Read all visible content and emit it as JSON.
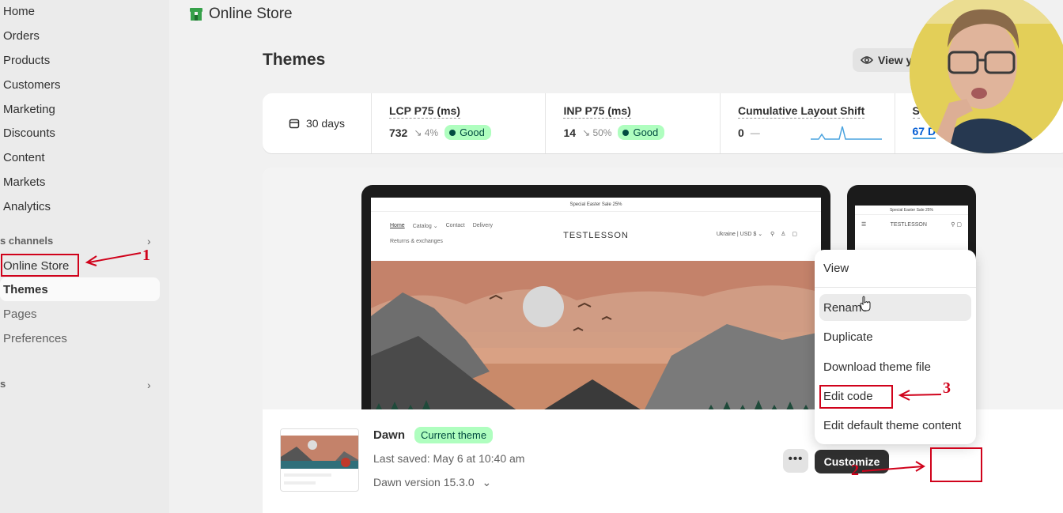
{
  "sidebar": {
    "items": [
      {
        "label": "Home"
      },
      {
        "label": "Orders"
      },
      {
        "label": "Products"
      },
      {
        "label": "Customers"
      },
      {
        "label": "Marketing"
      },
      {
        "label": "Discounts"
      },
      {
        "label": "Content"
      },
      {
        "label": "Markets"
      },
      {
        "label": "Analytics"
      }
    ],
    "sales_channels_label": "s channels",
    "online_store_label": "Online Store",
    "sub_items": [
      {
        "label": "Themes"
      },
      {
        "label": "Pages"
      },
      {
        "label": "Preferences"
      }
    ],
    "apps_label": "s"
  },
  "header": {
    "store_title": "Online Store"
  },
  "page": {
    "title": "Themes",
    "view_button_label": "View y"
  },
  "metrics": {
    "date_range": "30 days",
    "items": [
      {
        "label": "LCP P75 (ms)",
        "value": "732",
        "delta": "↘ 4%",
        "badge": "Good"
      },
      {
        "label": "INP P75 (ms)",
        "value": "14",
        "delta": "↘ 50%",
        "badge": "Good"
      },
      {
        "label": "Cumulative Layout Shift",
        "value": "0",
        "delta": "—"
      },
      {
        "label": "S",
        "value": "67 D"
      }
    ]
  },
  "preview": {
    "announcement": "Special Easter Sale 25%",
    "nav": [
      "Home",
      "Catalog ⌄",
      "Contact",
      "Delivery"
    ],
    "nav2": "Returns & exchanges",
    "logo": "TESTLESSON",
    "utility": "Ukraine | USD $ ⌄",
    "phone_announcement": "Special Easter Sale 25%",
    "phone_logo": "TESTLESSON"
  },
  "theme": {
    "name": "Dawn",
    "badge": "Current theme",
    "last_saved": "Last saved: May 6 at 10:40 am",
    "version": "Dawn version 15.3.0"
  },
  "actions": {
    "more_label": "•••",
    "customize_label": "Customize"
  },
  "menu": {
    "items": [
      {
        "label": "View"
      },
      {
        "label": "Rename"
      },
      {
        "label": "Duplicate"
      },
      {
        "label": "Download theme file"
      },
      {
        "label": "Edit code"
      },
      {
        "label": "Edit default theme content"
      }
    ]
  },
  "annotations": {
    "n1": "1",
    "n2": "2",
    "n3": "3",
    "color": "#d0021b"
  }
}
